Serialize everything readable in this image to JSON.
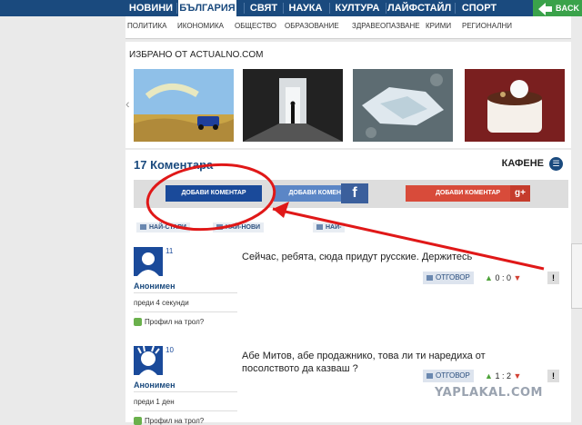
{
  "topnav": {
    "items": [
      "НОВИНИ",
      "БЪЛГАРИЯ",
      "СВЯТ",
      "НАУКА",
      "КУЛТУРА",
      "ЛАЙФСТАЙЛ",
      "СПОРТ"
    ],
    "back_label": "BACK"
  },
  "subnav": {
    "items": [
      "ПОЛИТИКА",
      "ИКОНОМИКА",
      "ОБЩЕСТВО",
      "ОБРАЗОВАНИЕ",
      "ЗДРАВЕОПАЗВАНЕ",
      "КРИМИ",
      "РЕГИОНАЛНИ"
    ]
  },
  "featured": {
    "title": "ИЗБРАНО ОТ ACTUALNO.COM"
  },
  "comments": {
    "title": "17 Коментара",
    "cafe_label": "КАФЕНЕ",
    "add_label": "ДОБАВИ КОМЕНТАР",
    "add_fb_label": "ДОБАВИ КОМЕНТАР",
    "add_g_label": "ДОБАВИ КОМЕНТАР",
    "sort": [
      "НАЙ-СТАРИ",
      "НАЙ-НОВИ",
      "НАЙ-"
    ],
    "items": [
      {
        "num": "11",
        "author": "Анонимен",
        "when": "преди 4 секунди",
        "troll": "Профил на трол?",
        "text": "Сейчас, ребята, сюда придут русские. Держитесь",
        "reply": "ОТГОВОР",
        "up": "0",
        "down": "0"
      },
      {
        "num": "10",
        "author": "Анонимен",
        "when": "преди 1 ден",
        "troll": "Профил на трол?",
        "text": "Абе Митов, абе продажнико, това ли ти наредиха от посолството да казваш ?",
        "reply": "ОТГОВОР",
        "up": "1",
        "down": "2"
      }
    ]
  },
  "watermark": "YAPLAKAL.COM"
}
